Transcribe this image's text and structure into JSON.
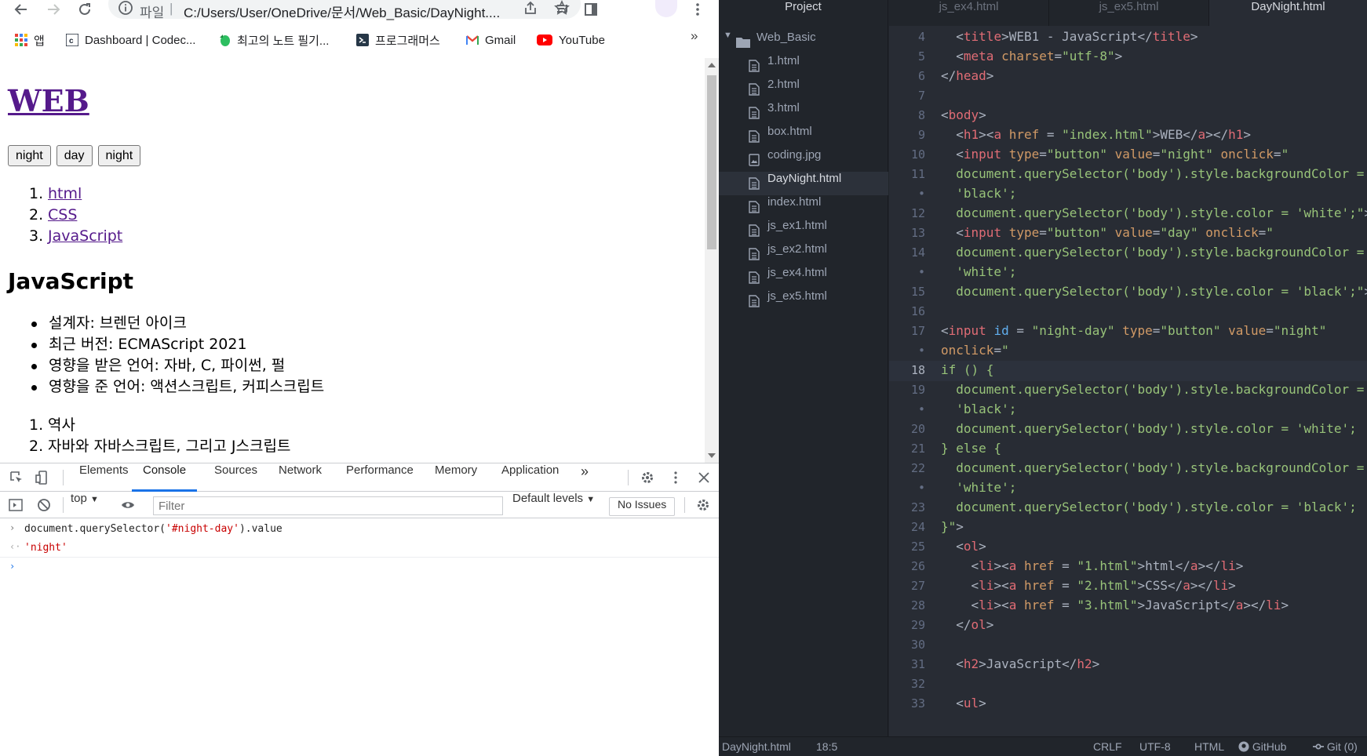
{
  "browser": {
    "omnibox": {
      "prefix": "파일",
      "url": "C:/Users/User/OneDrive/문서/Web_Basic/DayNight...."
    },
    "bookmarks": [
      {
        "label": "앱",
        "icon": "apps-grid-icon"
      },
      {
        "label": "Dashboard | Codec...",
        "icon": "codecademy-icon"
      },
      {
        "label": "최고의 노트 필기...",
        "icon": "evernote-icon"
      },
      {
        "label": "프로그래머스",
        "icon": "programmers-icon"
      },
      {
        "label": "Gmail",
        "icon": "gmail-icon"
      },
      {
        "label": "YouTube",
        "icon": "youtube-icon"
      }
    ],
    "bookmarks_more": "»"
  },
  "page": {
    "h1": "WEB",
    "buttons": [
      "night",
      "day",
      "night"
    ],
    "links": [
      {
        "num": "1.",
        "label": "html"
      },
      {
        "num": "2.",
        "label": "CSS"
      },
      {
        "num": "3.",
        "label": "JavaScript"
      }
    ],
    "h2": "JavaScript",
    "facts": [
      "설계자: 브렌던 아이크",
      "최근 버전: ECMAScript 2021",
      "영향을 받은 언어: 자바, C, 파이썬, 펄",
      "영향을 준 언어: 액션스크립트, 커피스크립트"
    ],
    "toc": [
      {
        "num": "1.",
        "label": "역사"
      },
      {
        "num": "2.",
        "label": "자바와 자바스크립트, 그리고 J스크립트"
      }
    ]
  },
  "devtools": {
    "tabs": [
      "Elements",
      "Console",
      "Sources",
      "Network",
      "Performance",
      "Memory",
      "Application"
    ],
    "active_tab": "Console",
    "more": "»",
    "context": "top",
    "filter_placeholder": "Filter",
    "levels": "Default levels",
    "issues": "No Issues",
    "console": {
      "input_prefix": "document.querySelector(",
      "input_string": "'#night-day'",
      "input_suffix": ").value",
      "output": "'night'"
    }
  },
  "atom": {
    "tabs": [
      "Project",
      "js_ex4.html",
      "js_ex5.html",
      "DayNight.html"
    ],
    "active_tab": "DayNight.html",
    "folder": "Web_Basic",
    "files": [
      {
        "name": "1.html",
        "icon": "file-text-icon"
      },
      {
        "name": "2.html",
        "icon": "file-text-icon"
      },
      {
        "name": "3.html",
        "icon": "file-text-icon"
      },
      {
        "name": "box.html",
        "icon": "file-text-icon"
      },
      {
        "name": "coding.jpg",
        "icon": "file-image-icon"
      },
      {
        "name": "DayNight.html",
        "icon": "file-text-icon"
      },
      {
        "name": "index.html",
        "icon": "file-text-icon"
      },
      {
        "name": "js_ex1.html",
        "icon": "file-text-icon"
      },
      {
        "name": "js_ex2.html",
        "icon": "file-text-icon"
      },
      {
        "name": "js_ex4.html",
        "icon": "file-text-icon"
      },
      {
        "name": "js_ex5.html",
        "icon": "file-text-icon"
      }
    ],
    "selected_file": "DayNight.html",
    "code": [
      {
        "n": "4",
        "tokens": [
          [
            "p",
            "  <"
          ],
          [
            "t",
            "title"
          ],
          [
            "p",
            ">WEB1 - JavaScript</"
          ],
          [
            "t",
            "title"
          ],
          [
            "p",
            ">"
          ]
        ]
      },
      {
        "n": "5",
        "tokens": [
          [
            "p",
            "  <"
          ],
          [
            "t",
            "meta"
          ],
          [
            "p",
            " "
          ],
          [
            "a",
            "charset"
          ],
          [
            "p",
            "="
          ],
          [
            "s",
            "\"utf-8\""
          ],
          [
            "p",
            ">"
          ]
        ]
      },
      {
        "n": "6",
        "tokens": [
          [
            "p",
            "</"
          ],
          [
            "t",
            "head"
          ],
          [
            "p",
            ">"
          ]
        ]
      },
      {
        "n": "7",
        "tokens": []
      },
      {
        "n": "8",
        "tokens": [
          [
            "p",
            "<"
          ],
          [
            "t",
            "body"
          ],
          [
            "p",
            ">"
          ]
        ]
      },
      {
        "n": "9",
        "tokens": [
          [
            "p",
            "  <"
          ],
          [
            "t",
            "h1"
          ],
          [
            "p",
            "><"
          ],
          [
            "t",
            "a"
          ],
          [
            "p",
            " "
          ],
          [
            "a",
            "href"
          ],
          [
            "p",
            " = "
          ],
          [
            "s",
            "\"index.html\""
          ],
          [
            "p",
            ">WEB</"
          ],
          [
            "t",
            "a"
          ],
          [
            "p",
            "></"
          ],
          [
            "t",
            "h1"
          ],
          [
            "p",
            ">"
          ]
        ]
      },
      {
        "n": "10",
        "tokens": [
          [
            "p",
            "  <"
          ],
          [
            "t",
            "input"
          ],
          [
            "p",
            " "
          ],
          [
            "a",
            "type"
          ],
          [
            "p",
            "="
          ],
          [
            "s",
            "\"button\""
          ],
          [
            "p",
            " "
          ],
          [
            "a",
            "value"
          ],
          [
            "p",
            "="
          ],
          [
            "s",
            "\"night\""
          ],
          [
            "p",
            " "
          ],
          [
            "a",
            "onclick"
          ],
          [
            "p",
            "="
          ],
          [
            "s",
            "\""
          ]
        ]
      },
      {
        "n": "11",
        "tokens": [
          [
            "s",
            "  document.querySelector('body').style.backgroundColor ="
          ]
        ]
      },
      {
        "n": "•",
        "tokens": [
          [
            "s",
            "  'black';"
          ]
        ]
      },
      {
        "n": "12",
        "tokens": [
          [
            "s",
            "  document.querySelector('body').style.color = 'white';\""
          ],
          [
            "p",
            ">"
          ]
        ]
      },
      {
        "n": "13",
        "tokens": [
          [
            "p",
            "  <"
          ],
          [
            "t",
            "input"
          ],
          [
            "p",
            " "
          ],
          [
            "a",
            "type"
          ],
          [
            "p",
            "="
          ],
          [
            "s",
            "\"button\""
          ],
          [
            "p",
            " "
          ],
          [
            "a",
            "value"
          ],
          [
            "p",
            "="
          ],
          [
            "s",
            "\"day\""
          ],
          [
            "p",
            " "
          ],
          [
            "a",
            "onclick"
          ],
          [
            "p",
            "="
          ],
          [
            "s",
            "\""
          ]
        ]
      },
      {
        "n": "14",
        "tokens": [
          [
            "s",
            "  document.querySelector('body').style.backgroundColor ="
          ]
        ]
      },
      {
        "n": "•",
        "tokens": [
          [
            "s",
            "  'white';"
          ]
        ]
      },
      {
        "n": "15",
        "tokens": [
          [
            "s",
            "  document.querySelector('body').style.color = 'black';\""
          ],
          [
            "p",
            ">"
          ]
        ]
      },
      {
        "n": "16",
        "tokens": []
      },
      {
        "n": "17",
        "tokens": [
          [
            "p",
            "<"
          ],
          [
            "t",
            "input"
          ],
          [
            "p",
            " "
          ],
          [
            "i",
            "id"
          ],
          [
            "p",
            " = "
          ],
          [
            "s",
            "\"night-day\""
          ],
          [
            "p",
            " "
          ],
          [
            "a",
            "type"
          ],
          [
            "p",
            "="
          ],
          [
            "s",
            "\"button\""
          ],
          [
            "p",
            " "
          ],
          [
            "a",
            "value"
          ],
          [
            "p",
            "="
          ],
          [
            "s",
            "\"night\""
          ]
        ]
      },
      {
        "n": "•",
        "tokens": [
          [
            "a",
            "onclick"
          ],
          [
            "p",
            "="
          ],
          [
            "s",
            "\""
          ]
        ]
      },
      {
        "n": "18",
        "tokens": [
          [
            "s",
            "if () {"
          ]
        ]
      },
      {
        "n": "19",
        "tokens": [
          [
            "s",
            "  document.querySelector('body').style.backgroundColor ="
          ]
        ]
      },
      {
        "n": "•",
        "tokens": [
          [
            "s",
            "  'black';"
          ]
        ]
      },
      {
        "n": "20",
        "tokens": [
          [
            "s",
            "  document.querySelector('body').style.color = 'white';"
          ]
        ]
      },
      {
        "n": "21",
        "tokens": [
          [
            "s",
            "} else {"
          ]
        ]
      },
      {
        "n": "22",
        "tokens": [
          [
            "s",
            "  document.querySelector('body').style.backgroundColor ="
          ]
        ]
      },
      {
        "n": "•",
        "tokens": [
          [
            "s",
            "  'white';"
          ]
        ]
      },
      {
        "n": "23",
        "tokens": [
          [
            "s",
            "  document.querySelector('body').style.color = 'black';"
          ]
        ]
      },
      {
        "n": "24",
        "tokens": [
          [
            "s",
            "}\""
          ],
          [
            "p",
            ">"
          ]
        ]
      },
      {
        "n": "25",
        "tokens": [
          [
            "p",
            "  <"
          ],
          [
            "t",
            "ol"
          ],
          [
            "p",
            ">"
          ]
        ]
      },
      {
        "n": "26",
        "tokens": [
          [
            "p",
            "    <"
          ],
          [
            "t",
            "li"
          ],
          [
            "p",
            "><"
          ],
          [
            "t",
            "a"
          ],
          [
            "p",
            " "
          ],
          [
            "a",
            "href"
          ],
          [
            "p",
            " = "
          ],
          [
            "s",
            "\"1.html\""
          ],
          [
            "p",
            ">html</"
          ],
          [
            "t",
            "a"
          ],
          [
            "p",
            "></"
          ],
          [
            "t",
            "li"
          ],
          [
            "p",
            ">"
          ]
        ]
      },
      {
        "n": "27",
        "tokens": [
          [
            "p",
            "    <"
          ],
          [
            "t",
            "li"
          ],
          [
            "p",
            "><"
          ],
          [
            "t",
            "a"
          ],
          [
            "p",
            " "
          ],
          [
            "a",
            "href"
          ],
          [
            "p",
            " = "
          ],
          [
            "s",
            "\"2.html\""
          ],
          [
            "p",
            ">CSS</"
          ],
          [
            "t",
            "a"
          ],
          [
            "p",
            "></"
          ],
          [
            "t",
            "li"
          ],
          [
            "p",
            ">"
          ]
        ]
      },
      {
        "n": "28",
        "tokens": [
          [
            "p",
            "    <"
          ],
          [
            "t",
            "li"
          ],
          [
            "p",
            "><"
          ],
          [
            "t",
            "a"
          ],
          [
            "p",
            " "
          ],
          [
            "a",
            "href"
          ],
          [
            "p",
            " = "
          ],
          [
            "s",
            "\"3.html\""
          ],
          [
            "p",
            ">JavaScript</"
          ],
          [
            "t",
            "a"
          ],
          [
            "p",
            "></"
          ],
          [
            "t",
            "li"
          ],
          [
            "p",
            ">"
          ]
        ]
      },
      {
        "n": "29",
        "tokens": [
          [
            "p",
            "  </"
          ],
          [
            "t",
            "ol"
          ],
          [
            "p",
            ">"
          ]
        ]
      },
      {
        "n": "30",
        "tokens": []
      },
      {
        "n": "31",
        "tokens": [
          [
            "p",
            "  <"
          ],
          [
            "t",
            "h2"
          ],
          [
            "p",
            ">JavaScript</"
          ],
          [
            "t",
            "h2"
          ],
          [
            "p",
            ">"
          ]
        ]
      },
      {
        "n": "32",
        "tokens": []
      },
      {
        "n": "33",
        "tokens": [
          [
            "p",
            "  <"
          ],
          [
            "t",
            "ul"
          ],
          [
            "p",
            ">"
          ]
        ]
      }
    ],
    "current_line": "18",
    "status": {
      "file": "DayNight.html",
      "cursor": "18:5",
      "line_ending": "CRLF",
      "encoding": "UTF-8",
      "grammar": "HTML",
      "github": "GitHub",
      "git": "Git (0)"
    }
  }
}
